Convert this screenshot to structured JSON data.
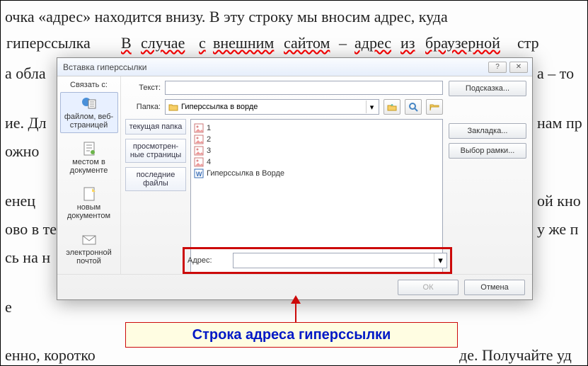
{
  "bg": {
    "l1": "очка «адрес» находится внизу. В эту строку мы вносим адрес, куда",
    "l2a": "гиперссылка",
    "l2b": "В",
    "l2c": "случае",
    "l2d": "с",
    "l2e": "внешним",
    "l2f": "сайтом",
    "l2g": "–",
    "l2h": "адрес",
    "l2i": "из",
    "l2j": "браузерной",
    "l2k": "стр",
    "l3a": "а обла",
    "l3b": "а – то",
    "l4a": "ие.  Дл",
    "l4b": "нам пр",
    "l5a": "ожно",
    "l6a": "енец",
    "l6b": "ой кно",
    "l7a": "ово в те",
    "l7b": "у же п",
    "l8a": "сь на н",
    "l9a": "е",
    "l10a": "енно, коротко",
    "l10b": "де. Получайте уд"
  },
  "dialog": {
    "title": "Вставка гиперссылки",
    "link_with": "Связать с:",
    "text_label": "Текст:",
    "text_value": "",
    "tooltip_btn": "Подсказка...",
    "folder_label": "Папка:",
    "folder_value": "Гиперссылка в ворде",
    "left": {
      "file_web": "файлом, веб-страницей",
      "place_doc": "местом в документе",
      "new_doc": "новым документом",
      "email": "электронной почтой"
    },
    "tabs": {
      "current": "текущая папка",
      "viewed": "просмотрен-ные страницы",
      "recent": "последние файлы"
    },
    "list": [
      "1",
      "2",
      "3",
      "4",
      "Гиперссылка в Ворде"
    ],
    "bookmark_btn": "Закладка...",
    "frame_btn": "Выбор рамки...",
    "address_label": "Адрес:",
    "address_value": "",
    "ok": "ОК",
    "cancel": "Отмена"
  },
  "callout": "Строка адреса гиперссылки"
}
